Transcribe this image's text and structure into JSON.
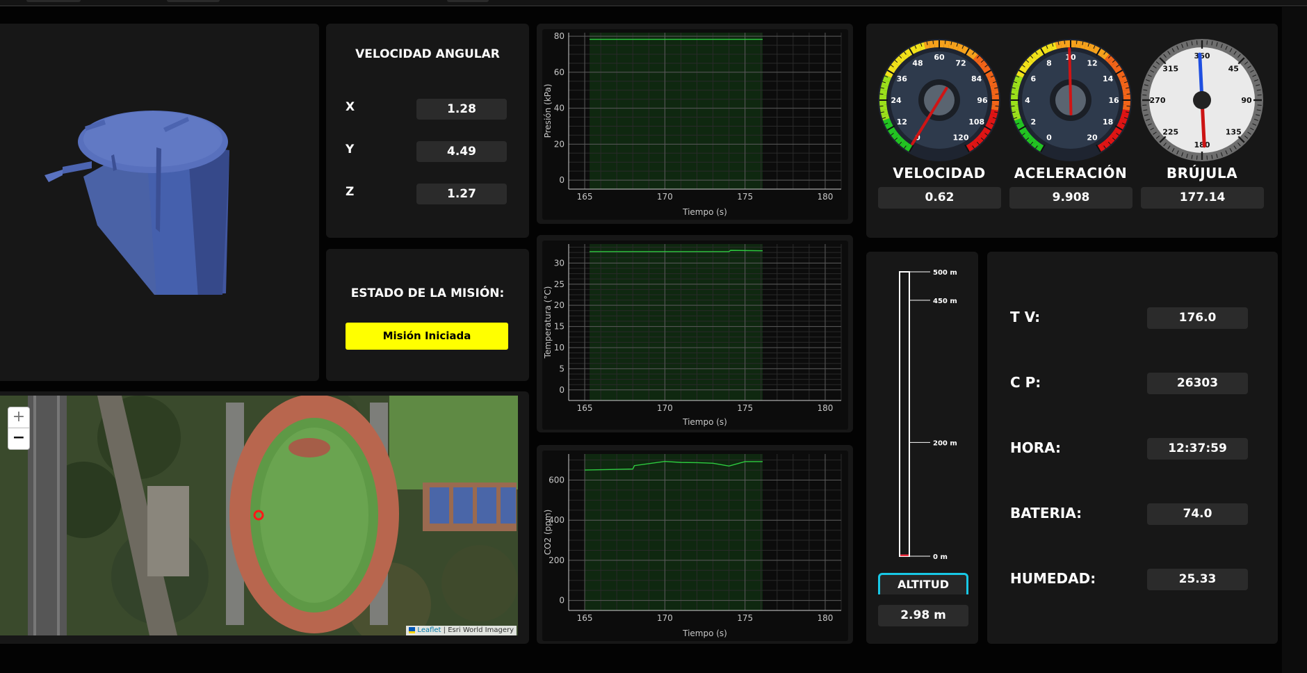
{
  "angular_velocity": {
    "title": "VELOCIDAD ANGULAR",
    "rows": [
      {
        "label": "X",
        "value": "1.28"
      },
      {
        "label": "Y",
        "value": "4.49"
      },
      {
        "label": "Z",
        "value": "1.27"
      }
    ]
  },
  "mission": {
    "title": "ESTADO DE LA MISIÓN:",
    "status": "Misión Iniciada",
    "status_color": "#ffff00"
  },
  "map": {
    "zoom_in": "+",
    "zoom_out": "−",
    "attribution_link": "Leaflet",
    "attribution_sep": " | ",
    "attribution_source": "Esri World Imagery"
  },
  "chart_data": [
    {
      "type": "line",
      "ylabel": "Presión (kPa)",
      "xlabel": "Tiempo (s)",
      "xlim": [
        164,
        181
      ],
      "ylim": [
        -5,
        82
      ],
      "xticks": [
        "165",
        "170",
        "175",
        "180"
      ],
      "yticks": [
        "0",
        "20",
        "40",
        "60",
        "80"
      ],
      "series": [
        {
          "x": [
            165.3,
            176.1
          ],
          "y": [
            78.3,
            78.3
          ]
        }
      ]
    },
    {
      "type": "line",
      "ylabel": "Temperatura (°C)",
      "xlabel": "Tiempo (s)",
      "xlim": [
        164,
        181
      ],
      "ylim": [
        -2.5,
        34.5
      ],
      "xticks": [
        "165",
        "170",
        "175",
        "180"
      ],
      "yticks": [
        "0",
        "5",
        "10",
        "15",
        "20",
        "25",
        "30"
      ],
      "series": [
        {
          "x": [
            165.3,
            174.0,
            174.1,
            176.1
          ],
          "y": [
            32.7,
            32.7,
            33.0,
            32.9
          ]
        }
      ]
    },
    {
      "type": "line",
      "ylabel": "CO2 (ppm)",
      "xlabel": "Tiempo (s)",
      "xlim": [
        164,
        181
      ],
      "ylim": [
        -50,
        730
      ],
      "xticks": [
        "165",
        "170",
        "175",
        "180"
      ],
      "yticks": [
        "0",
        "200",
        "400",
        "600"
      ],
      "series": [
        {
          "x": [
            165.0,
            168.0,
            168.1,
            170.0,
            171.0,
            172.0,
            173.0,
            174.0,
            175.0,
            176.1
          ],
          "y": [
            650,
            655,
            672,
            693,
            688,
            687,
            684,
            670,
            692,
            692
          ]
        }
      ]
    }
  ],
  "gauges": {
    "velocity": {
      "title": "VELOCIDAD",
      "value": "0.62",
      "ticks": [
        "0",
        "12",
        "24",
        "36",
        "48",
        "60",
        "72",
        "84",
        "96",
        "108",
        "120"
      ]
    },
    "acceleration": {
      "title": "ACELERACIÓN",
      "value": "9.908",
      "ticks": [
        "0",
        "2",
        "4",
        "6",
        "8",
        "10",
        "12",
        "14",
        "16",
        "18",
        "20"
      ]
    },
    "compass": {
      "title": "BRÚJULA",
      "value": "177.14",
      "ticks": [
        "360",
        "45",
        "90",
        "135",
        "180",
        "225",
        "270",
        "315"
      ]
    }
  },
  "altitude": {
    "title": "ALTITUD",
    "value": "2.98 m",
    "ticks": [
      "500 m",
      "450 m",
      "200 m",
      "0 m"
    ],
    "accent_color": "#18c8e6"
  },
  "telemetry": [
    {
      "label": "T V:",
      "value": "176.0"
    },
    {
      "label": "C P:",
      "value": "26303"
    },
    {
      "label": "HORA:",
      "value": "12:37:59"
    },
    {
      "label": "BATERIA:",
      "value": "74.0"
    },
    {
      "label": "HUMEDAD:",
      "value": "25.33"
    }
  ],
  "colors": {
    "panel": "#171717",
    "value_box": "#2b2b2b",
    "chart_line": "#2ecc40",
    "model": "#4a62a6"
  }
}
